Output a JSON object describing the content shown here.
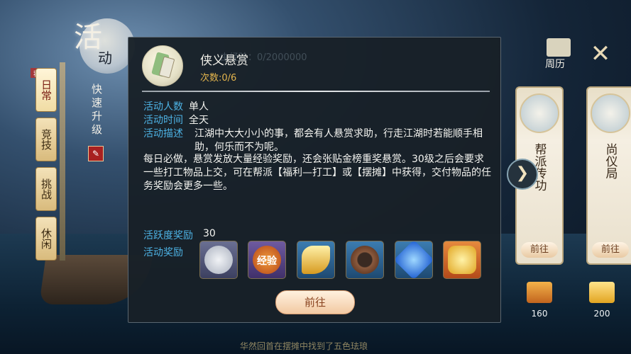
{
  "left": {
    "big_char": "活",
    "small_char": "动",
    "quick_upgrade": "快速升级",
    "tabs": [
      {
        "label": "日常",
        "active": true
      },
      {
        "label": "竞技",
        "active": false
      },
      {
        "label": "挑战",
        "active": false
      },
      {
        "label": "休闲",
        "active": false
      }
    ],
    "tag": "荐"
  },
  "topright": {
    "calendar_label": "周历"
  },
  "panel": {
    "faint_text": "由经验：0/2000000",
    "title": "侠义悬赏",
    "count": "次数:0/6",
    "people_label": "活动人数",
    "people_value": "单人",
    "time_label": "活动时间",
    "time_value": "全天",
    "desc_label": "活动描述",
    "desc_line1": "江湖中大大小小的事，都会有人悬赏求助，行走江湖时若能顺手相助，何乐而不为呢。",
    "desc_line2": "每日必做，悬赏发放大量经验奖励，还会张贴金榜重奖悬赏。30级之后会要求一些打工物品上交，可在帮派【福利—打工】或【摆摊】中获得，交付物品的任务奖励会更多一些。",
    "active_label": "活跃度奖励",
    "active_value": "30",
    "reward_label": "活动奖励",
    "rewards": [
      {
        "name": "silver-coin",
        "text": ""
      },
      {
        "name": "experience",
        "text": "经验"
      },
      {
        "name": "golden-fang",
        "text": ""
      },
      {
        "name": "rope-coil",
        "text": ""
      },
      {
        "name": "blue-gem",
        "text": ""
      },
      {
        "name": "gold-ingot",
        "text": ""
      }
    ],
    "go_button": "前往"
  },
  "cards": [
    {
      "title": "帮派传功",
      "go": "前往"
    },
    {
      "title": "尚仪局",
      "go": "前往"
    }
  ],
  "gifts": [
    {
      "value": "160"
    },
    {
      "value": "200"
    }
  ],
  "ticker": "华然回首在摆摊中找到了五色珐琅"
}
